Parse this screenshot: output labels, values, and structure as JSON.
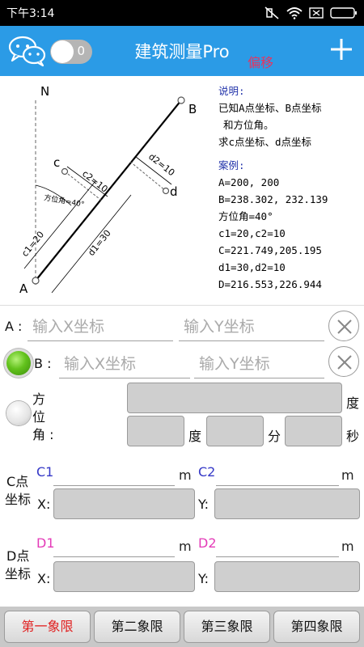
{
  "status": {
    "time": "下午3:14"
  },
  "header": {
    "title": "建筑测量Pro",
    "badge": "偏移",
    "toggle_value": "0"
  },
  "diagram": {
    "labels": {
      "north": "N",
      "a": "A",
      "b": "B",
      "c": "c",
      "d": "d",
      "c1": "c1=20",
      "c2": "c2=10",
      "d1": "d1=30",
      "d2": "d2=10",
      "angle": "方位角=40°"
    }
  },
  "notes": {
    "title": "说明:",
    "lines": [
      "已知A点坐标、B点坐标",
      "和方位角。",
      "求c点坐标、d点坐标"
    ],
    "example_title": "案例:",
    "example": [
      "A=200, 200",
      "B=238.302, 232.139",
      "方位角=40°",
      "c1=20,c2=10",
      "C=221.749,205.195",
      "d1=30,d2=10",
      "D=216.553,226.944"
    ]
  },
  "form": {
    "a_label": "A :",
    "b_label": "B :",
    "x_placeholder": "输入X坐标",
    "y_placeholder": "输入Y坐标",
    "azimuth_label": [
      "方",
      "位",
      "角 :"
    ],
    "unit_degree": "度",
    "unit_minute": "分",
    "unit_second": "秒",
    "c_label": [
      "C点",
      "坐标"
    ],
    "d_label": [
      "D点",
      "坐标"
    ],
    "c1": "C1",
    "c2": "C2",
    "d1": "D1",
    "d2": "D2",
    "unit_m": "m",
    "x_label": "X:",
    "y_label": "Y:"
  },
  "tabs": [
    "第一象限",
    "第二象限",
    "第三象限",
    "第四象限"
  ],
  "colors": {
    "header": "#2b9be6",
    "active_tab": "#e02020",
    "accent_pink": "#e43bb8",
    "accent_blue": "#3538c7"
  }
}
